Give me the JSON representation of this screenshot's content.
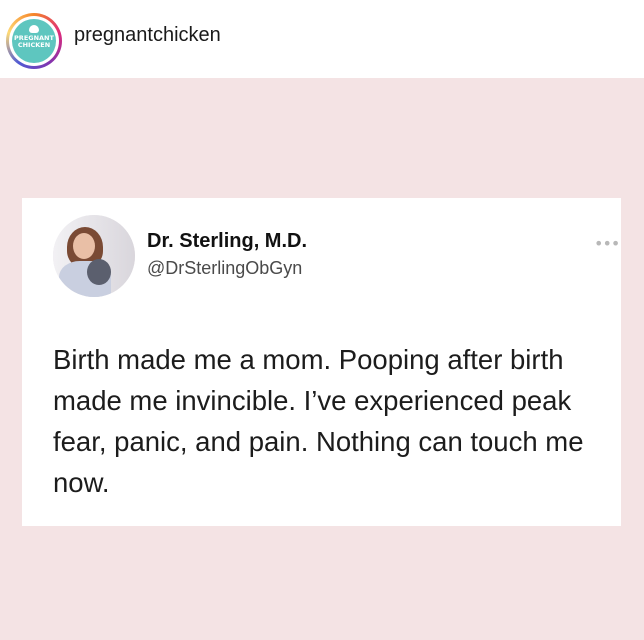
{
  "header": {
    "username": "pregnantchicken",
    "avatar_logo_text": "PREGNANT CHICKEN",
    "avatar_logo_line1": "PREGNANT",
    "avatar_logo_line2": "CHICKEN",
    "avatar_color": "#5ec6bf"
  },
  "post": {
    "background_color": "#f4e3e4",
    "tweet": {
      "display_name": "Dr. Sterling, M.D.",
      "handle": "@DrSterlingObGyn",
      "more_icon": "more-horizontal-icon",
      "more_glyph": "•••",
      "text": "Birth made me a mom. Pooping after birth made me invincible. I’ve experienced peak fear, panic, and pain. Nothing can touch me now."
    }
  }
}
